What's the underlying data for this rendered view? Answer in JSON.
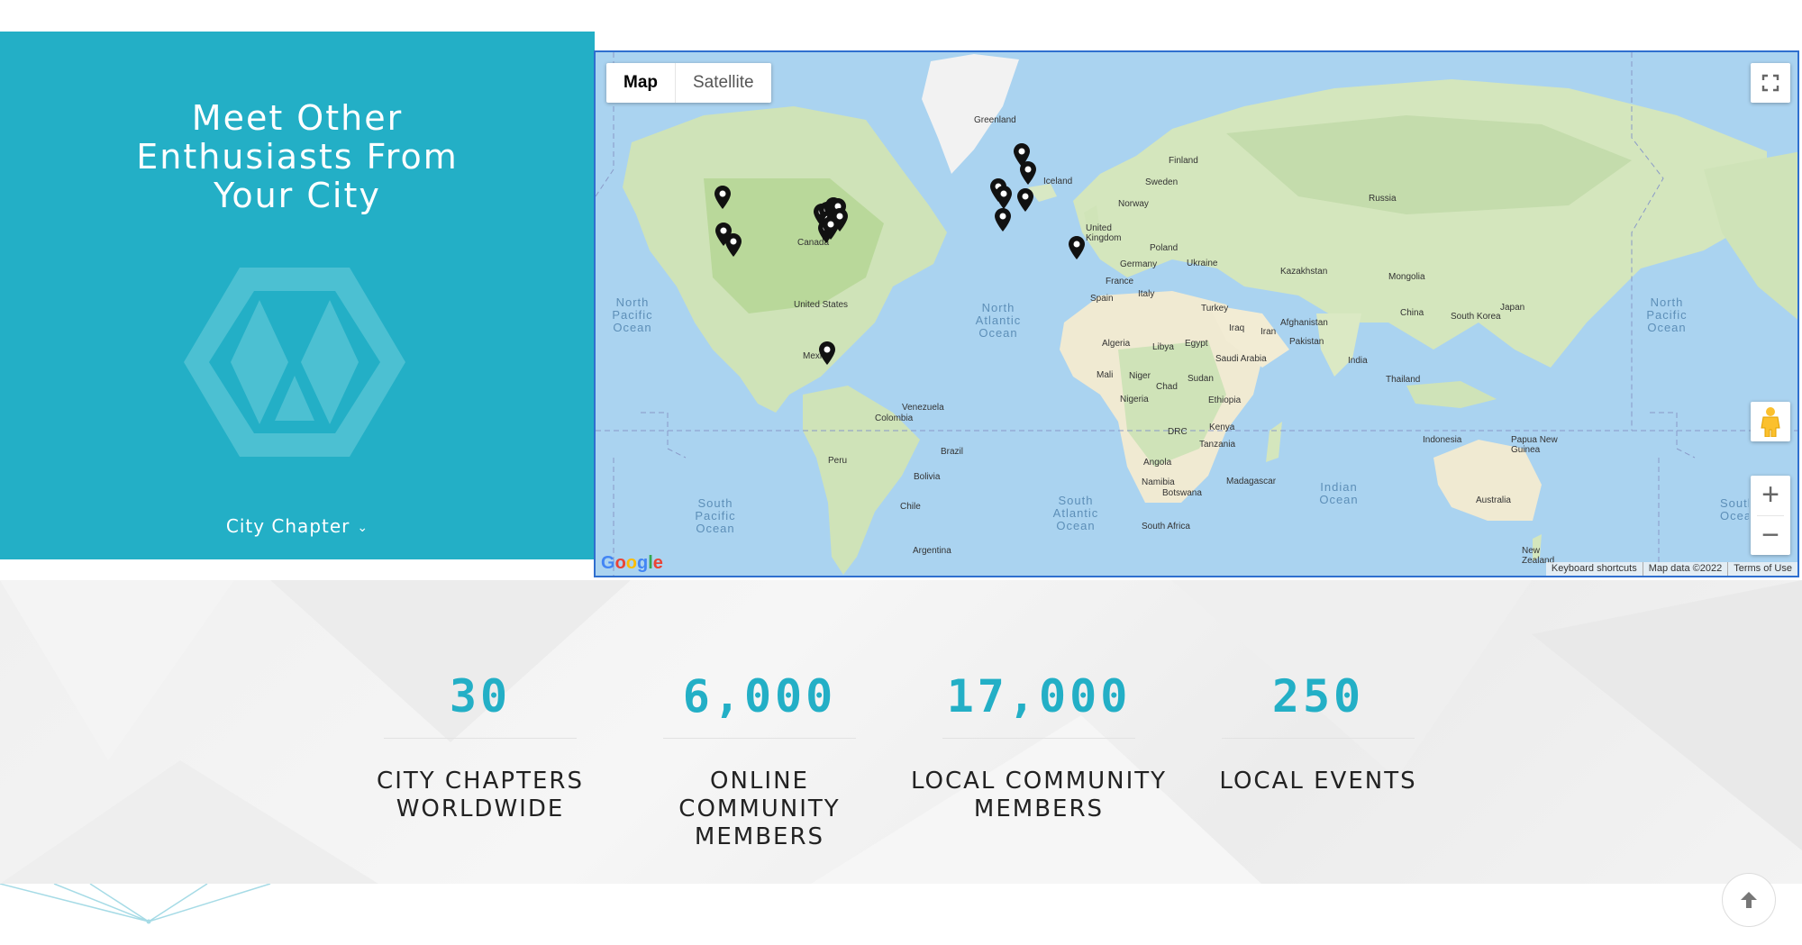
{
  "side_panel": {
    "title_lines": [
      "Meet Other",
      "Enthusiasts From",
      "Your City"
    ],
    "logo_icon": "hexagon-logo-icon",
    "chapter_label": "City Chapter",
    "chapter_icon": "chevron-down-icon",
    "background": "#23afc6"
  },
  "map": {
    "type_buttons": [
      "Map",
      "Satellite"
    ],
    "active_type": "Map",
    "fullscreen_icon": "fullscreen-icon",
    "pegman_icon": "pegman-icon",
    "zoom_in": "+",
    "zoom_out": "−",
    "logo": "Google",
    "attribution": [
      "Keyboard shortcuts",
      "Map data ©2022",
      "Terms of Use"
    ],
    "labels": {
      "greenland": "Greenland",
      "iceland": "Iceland",
      "finland": "Finland",
      "sweden": "Sweden",
      "norway": "Norway",
      "russia": "Russia",
      "uk": "United Kingdom",
      "poland": "Poland",
      "germany": "Germany",
      "ukraine": "Ukraine",
      "france": "France",
      "italy": "Italy",
      "spain": "Spain",
      "kazakhstan": "Kazakhstan",
      "mongolia": "Mongolia",
      "turkey": "Turkey",
      "iraq": "Iraq",
      "iran": "Iran",
      "afghanistan": "Afghanistan",
      "pakistan": "Pakistan",
      "china": "China",
      "south_korea": "South Korea",
      "japan": "Japan",
      "india": "India",
      "thailand": "Thailand",
      "algeria": "Algeria",
      "libya": "Libya",
      "egypt": "Egypt",
      "saudi": "Saudi Arabia",
      "mali": "Mali",
      "niger": "Niger",
      "chad": "Chad",
      "sudan": "Sudan",
      "nigeria": "Nigeria",
      "ethiopia": "Ethiopia",
      "drc": "DRC",
      "kenya": "Kenya",
      "tanzania": "Tanzania",
      "angola": "Angola",
      "namibia": "Namibia",
      "botswana": "Botswana",
      "south_africa": "South Africa",
      "madagascar": "Madagascar",
      "indonesia": "Indonesia",
      "png": "Papua New Guinea",
      "australia": "Australia",
      "new_zealand": "New Zealand",
      "canada": "Canada",
      "united_states": "United States",
      "mexico": "Mexico",
      "venezuela": "Venezuela",
      "colombia": "Colombia",
      "peru": "Peru",
      "brazil": "Brazil",
      "bolivia": "Bolivia",
      "chile": "Chile",
      "argentina": "Argentina"
    },
    "oceans": {
      "north_pacific_w": "North Pacific Ocean",
      "north_atlantic": "North Atlantic Ocean",
      "south_pacific": "South Pacific Ocean",
      "south_atlantic": "South Atlantic Ocean",
      "indian": "Indian Ocean",
      "north_pacific_e": "North Pacific Ocean",
      "south_pacific_e": "South Ocean"
    },
    "marker_count": 22
  },
  "stats": [
    {
      "number": "30",
      "caption_lines": [
        "CITY CHAPTERS",
        "WORLDWIDE"
      ]
    },
    {
      "number": "6,000",
      "caption_lines": [
        "ONLINE COMMUNITY",
        "MEMBERS"
      ]
    },
    {
      "number": "17,000",
      "caption_lines": [
        "LOCAL COMMUNITY",
        "MEMBERS"
      ]
    },
    {
      "number": "250",
      "caption_lines": [
        "LOCAL EVENTS"
      ]
    }
  ],
  "back_to_top_icon": "arrow-up-icon"
}
